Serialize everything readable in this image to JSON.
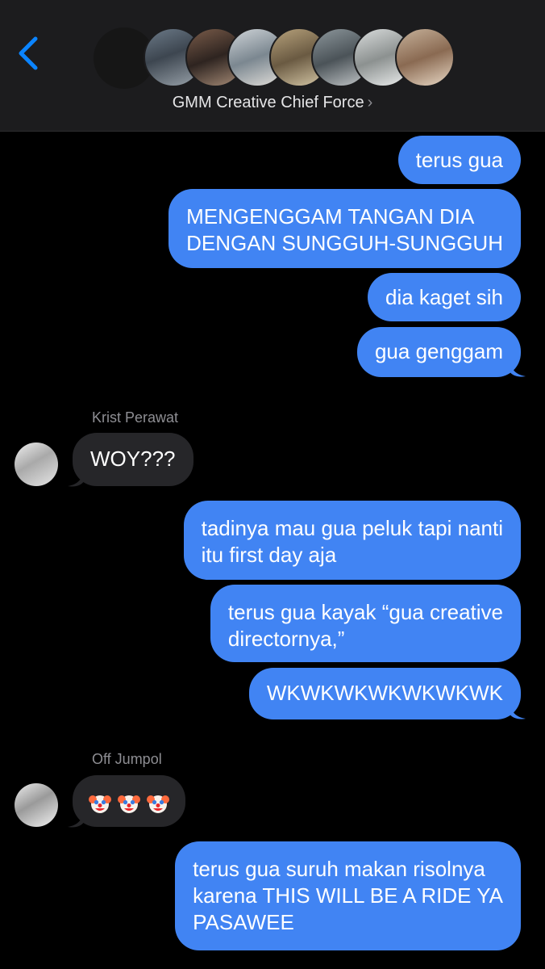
{
  "header": {
    "group_name": "GMM Creative Chief Force",
    "chevron": "›",
    "back_icon": "chevron-left-icon",
    "member_avatar_count": 8
  },
  "colors": {
    "outgoing_bubble": "#4184f3",
    "incoming_bubble": "#262629",
    "accent": "#0a84ff",
    "background": "#000000"
  },
  "messages": [
    {
      "direction": "out",
      "lines": [
        "terus gua"
      ]
    },
    {
      "direction": "out",
      "lines": [
        "MENGENGGAM TANGAN DIA",
        "DENGAN SUNGGUH-SUNGGUH"
      ]
    },
    {
      "direction": "out",
      "lines": [
        "dia kaget sih"
      ]
    },
    {
      "direction": "out",
      "lines": [
        "gua genggam"
      ]
    },
    {
      "direction": "in",
      "sender": "Krist Perawat",
      "lines": [
        "WOY???"
      ]
    },
    {
      "direction": "out",
      "lines": [
        "tadinya mau gua peluk tapi nanti",
        "itu first day aja"
      ]
    },
    {
      "direction": "out",
      "lines": [
        "terus gua kayak “gua creative",
        "directornya,”"
      ]
    },
    {
      "direction": "out",
      "lines": [
        "WKWKWKWKWKWKWK"
      ]
    },
    {
      "direction": "in",
      "sender": "Off Jumpol",
      "emoji": [
        "clown-face-icon",
        "clown-face-icon",
        "clown-face-icon"
      ]
    },
    {
      "direction": "out",
      "lines": [
        "terus gua suruh makan risolnya",
        "karena THIS WILL BE A RIDE YA",
        "PASAWEE"
      ]
    }
  ]
}
